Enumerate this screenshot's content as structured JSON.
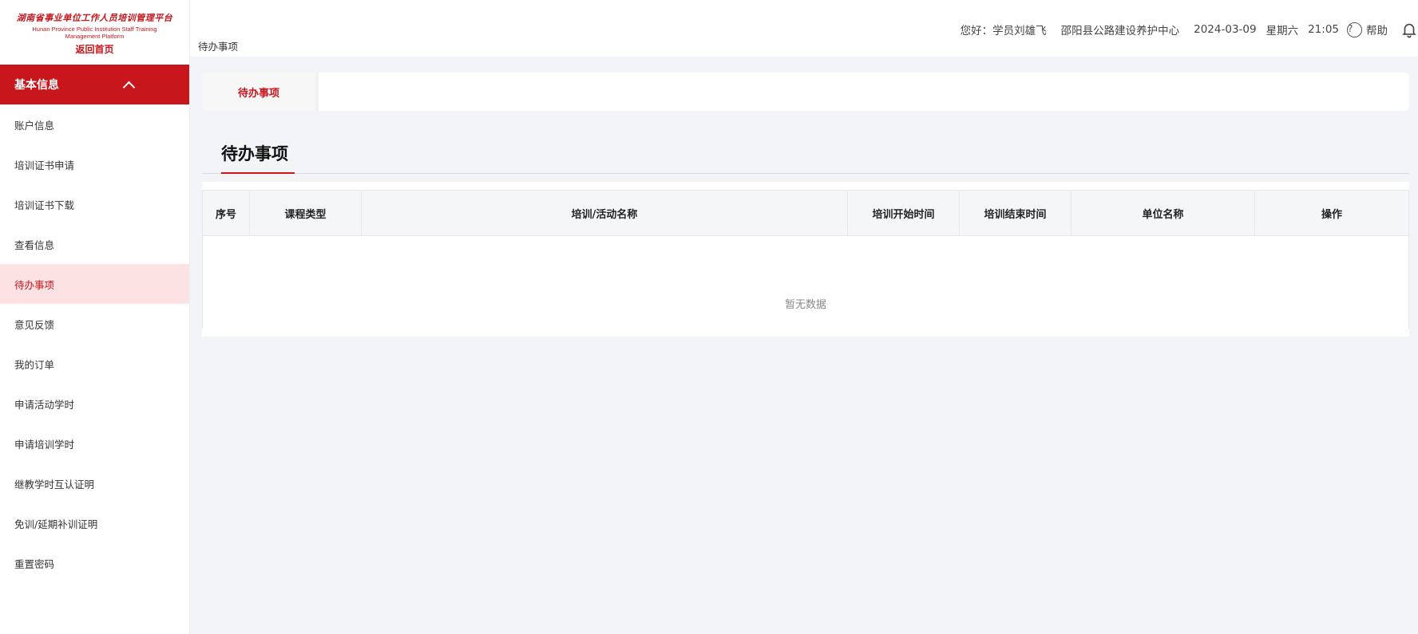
{
  "logo": {
    "cn": "湖南省事业单位工作人员培训管理平台",
    "en": "Hunan Province Public Institution Staff Training Management Platform",
    "home_link": "返回首页"
  },
  "sidebar": {
    "section": "基本信息",
    "items": [
      {
        "label": "账户信息"
      },
      {
        "label": "培训证书申请"
      },
      {
        "label": "培训证书下载"
      },
      {
        "label": "查看信息"
      },
      {
        "label": "待办事项",
        "active": true
      },
      {
        "label": "意见反馈"
      },
      {
        "label": "我的订单"
      },
      {
        "label": "申请活动学时"
      },
      {
        "label": "申请培训学时"
      },
      {
        "label": "继教学时互认证明"
      },
      {
        "label": "免训/延期补训证明"
      },
      {
        "label": "重置密码"
      }
    ]
  },
  "topbar": {
    "breadcrumb": "待办事项",
    "greeting": "您好：学员刘雄飞",
    "org": "邵阳县公路建设养护中心",
    "date": "2024-03-09",
    "weekday": "星期六",
    "time": "21:05",
    "help": "帮助"
  },
  "tabs": [
    {
      "label": "待办事项"
    }
  ],
  "main": {
    "title": "待办事项",
    "table": {
      "columns": [
        "序号",
        "课程类型",
        "培训/活动名称",
        "培训开始时间",
        "培训结束时间",
        "单位名称",
        "操作"
      ],
      "empty_text": "暂无数据"
    }
  },
  "colors": {
    "brand": "#c8161d",
    "active_bg": "#fde2e4",
    "page_bg": "#f3f4f8"
  }
}
